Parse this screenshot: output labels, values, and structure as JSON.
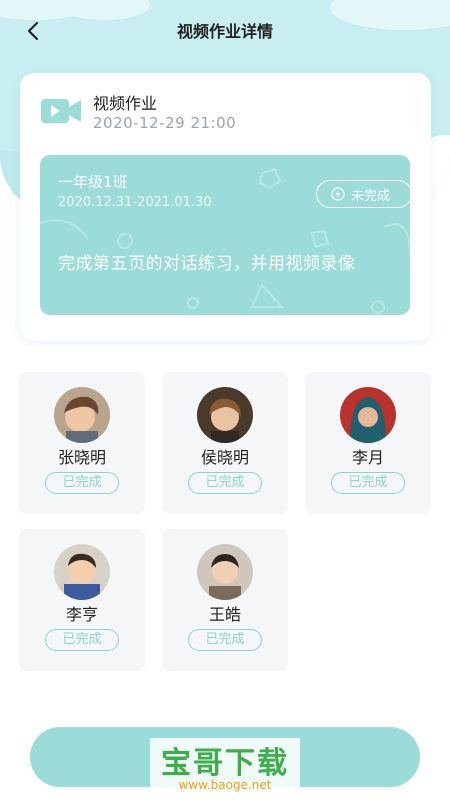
{
  "header": {
    "title": "视频作业详情",
    "back_icon": "chevron-left-icon"
  },
  "homework": {
    "type_label": "视频作业",
    "datetime": "2020-12-29 21:00",
    "icon": "video-camera-icon",
    "accent_color": "#9bdcd8"
  },
  "task": {
    "class_name": "一年级1班",
    "date_range": "2020.12.31-2021.01.30",
    "status": "未完成",
    "status_icon": "lightning-icon",
    "description": "完成第五页的对话练习，并用视频录像"
  },
  "students": [
    {
      "name": "张晓明",
      "status": "已完成"
    },
    {
      "name": "侯晓明",
      "status": "已完成"
    },
    {
      "name": "李月",
      "status": "已完成"
    },
    {
      "name": "李亨",
      "status": "已完成"
    },
    {
      "name": "王皓",
      "status": "已完成"
    }
  ],
  "watermark": {
    "main": "宝哥下载",
    "url": "www.baoge.net"
  }
}
